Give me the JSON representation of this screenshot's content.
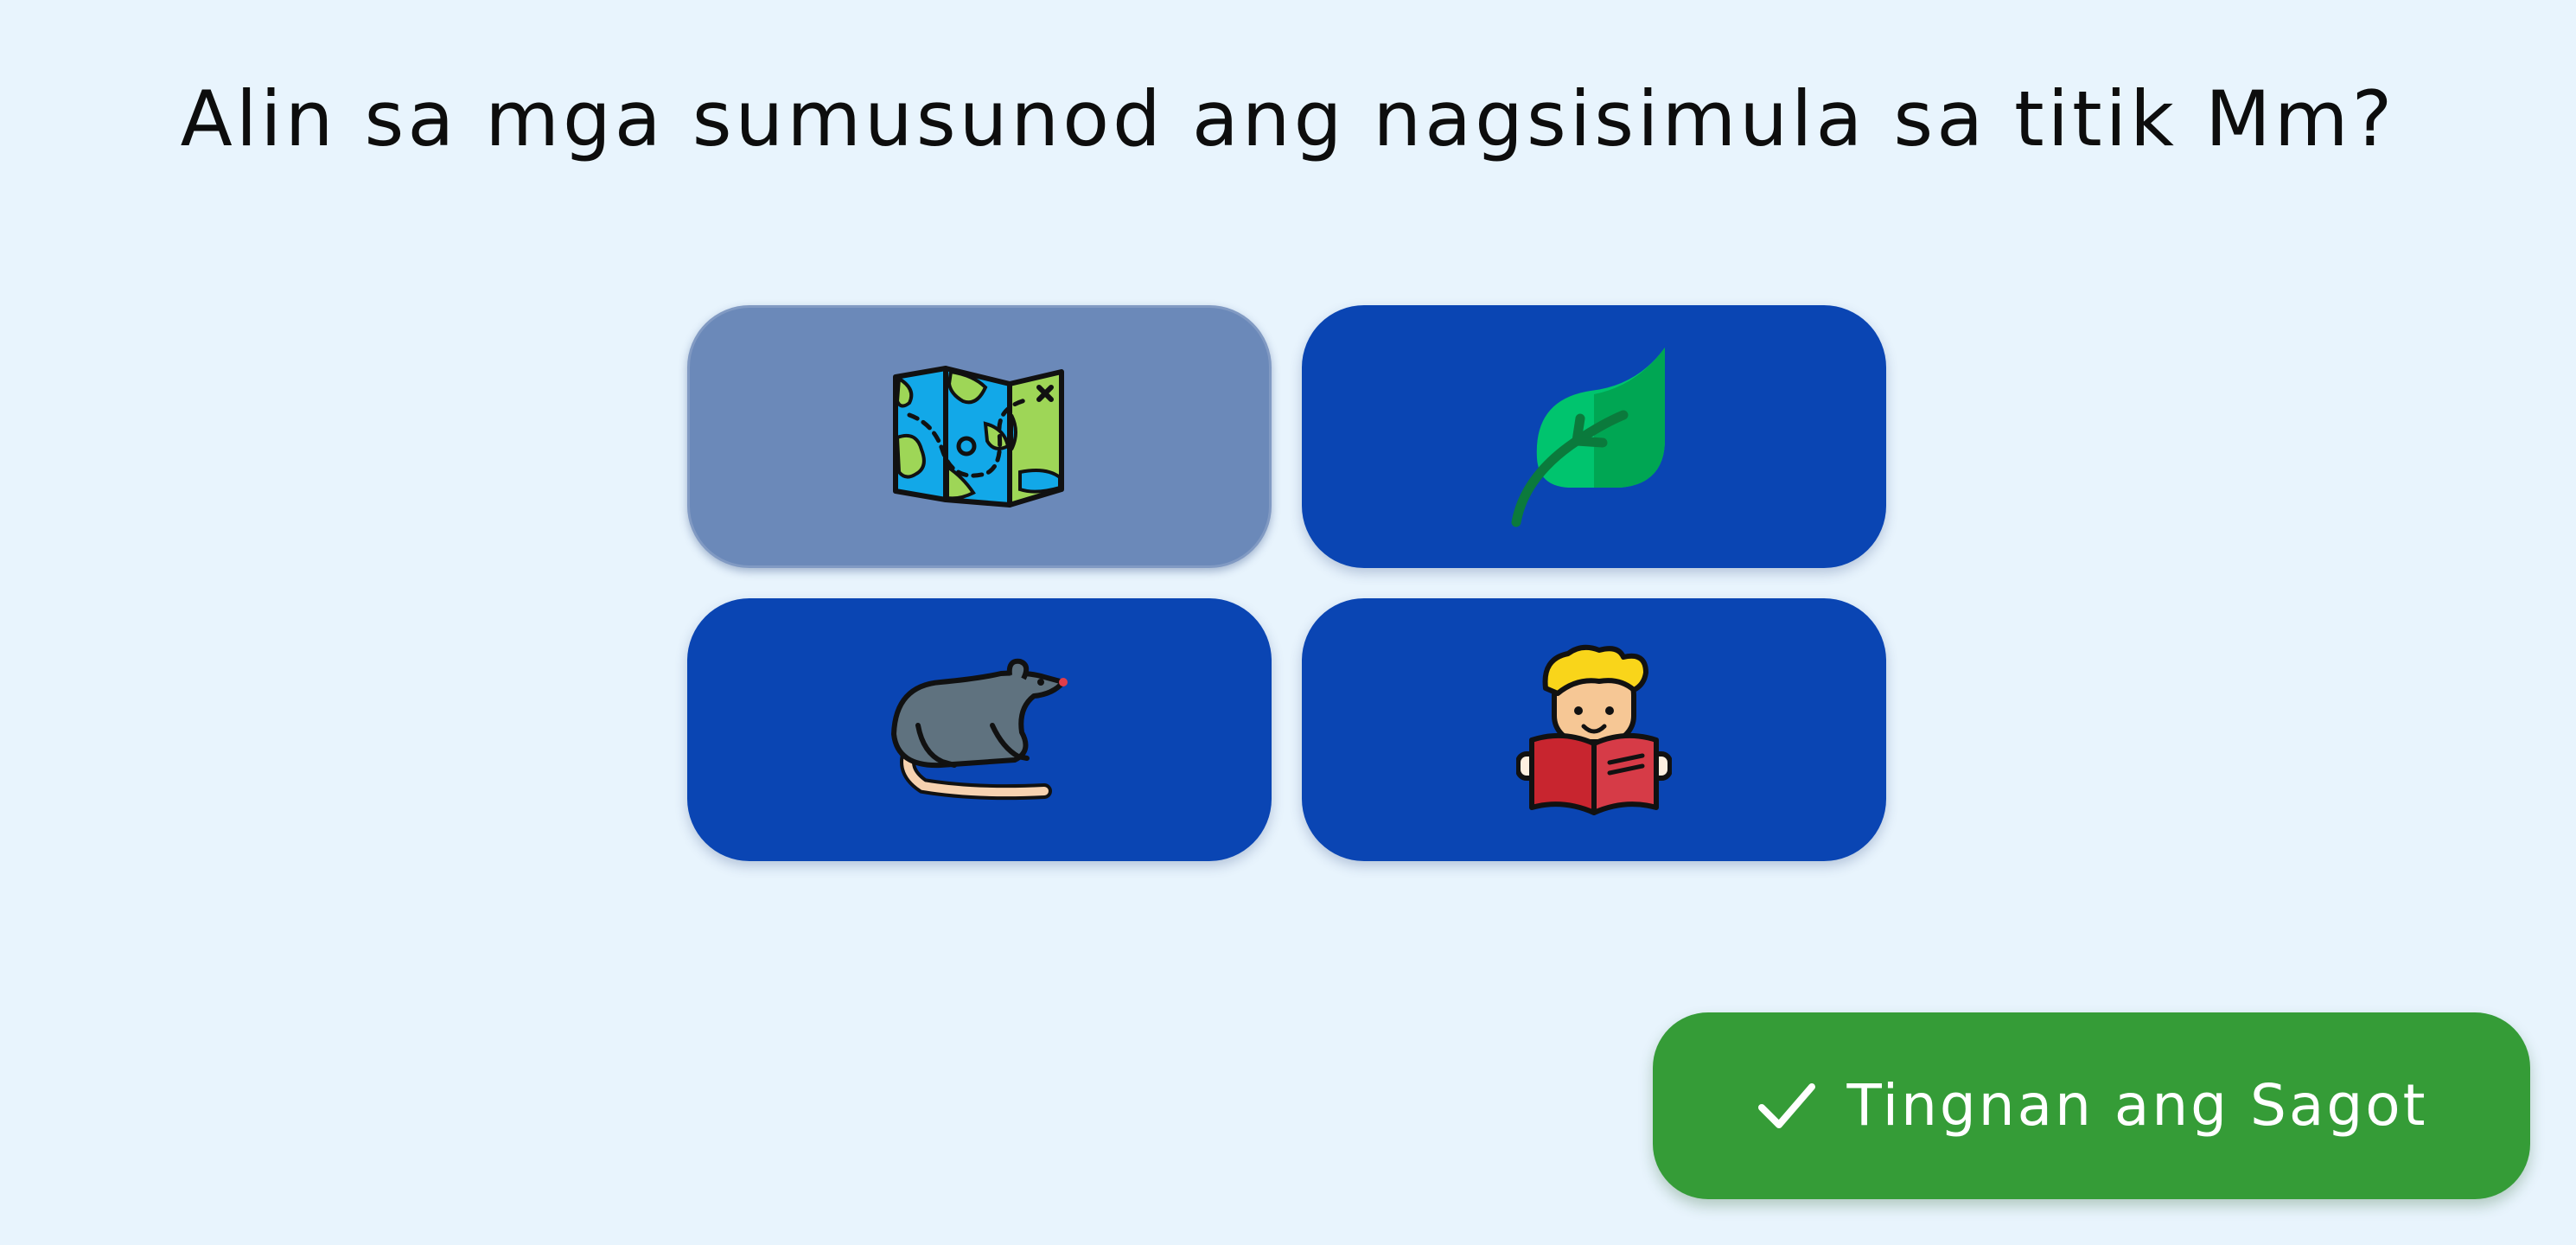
{
  "question": "Alin sa mga sumusunod ang nagsisimula sa titik Mm?",
  "choices": [
    {
      "icon": "map-icon",
      "selected": true
    },
    {
      "icon": "leaf-icon",
      "selected": false
    },
    {
      "icon": "rat-icon",
      "selected": false
    },
    {
      "icon": "boy-reading-book-icon",
      "selected": false
    }
  ],
  "check_button": {
    "label": "Tingnan ang Sagot",
    "icon": "checkmark-icon"
  },
  "colors": {
    "background": "#e8f4fd",
    "choice": "#0a45b3",
    "choice_selected": "#6b89b9",
    "check_button": "#359c37"
  }
}
